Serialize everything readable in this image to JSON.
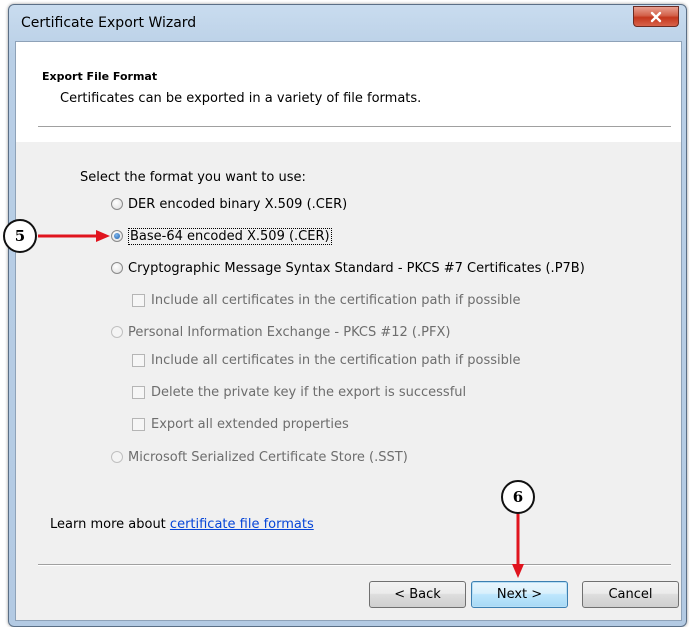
{
  "window": {
    "title": "Certificate Export Wizard",
    "close_glyph": "✕"
  },
  "header": {
    "heading": "Export File Format",
    "subheading": "Certificates can be exported in a variety of file formats."
  },
  "form": {
    "prompt": "Select the format you want to use:",
    "options": [
      {
        "label": "DER encoded binary X.509 (.CER)",
        "selected": false,
        "enabled": true
      },
      {
        "label": "Base-64 encoded X.509 (.CER)",
        "selected": true,
        "enabled": true
      },
      {
        "label": "Cryptographic Message Syntax Standard - PKCS #7 Certificates (.P7B)",
        "selected": false,
        "enabled": true
      },
      {
        "label": "Personal Information Exchange - PKCS #12 (.PFX)",
        "selected": false,
        "enabled": false
      },
      {
        "label": "Microsoft Serialized Certificate Store (.SST)",
        "selected": false,
        "enabled": false
      }
    ],
    "checkboxes": [
      {
        "label": "Include all certificates in the certification path if possible",
        "checked": false,
        "enabled": false
      },
      {
        "label": "Include all certificates in the certification path if possible",
        "checked": false,
        "enabled": false
      },
      {
        "label": "Delete the private key if the export is successful",
        "checked": false,
        "enabled": false
      },
      {
        "label": "Export all extended properties",
        "checked": false,
        "enabled": false
      }
    ]
  },
  "footer": {
    "learn_prefix": "Learn more about ",
    "learn_link": "certificate file formats"
  },
  "buttons": {
    "back": "< Back",
    "next": "Next >",
    "cancel": "Cancel"
  },
  "annotations": {
    "step5": "5",
    "step6": "6",
    "arrow_color": "#e0141e"
  }
}
